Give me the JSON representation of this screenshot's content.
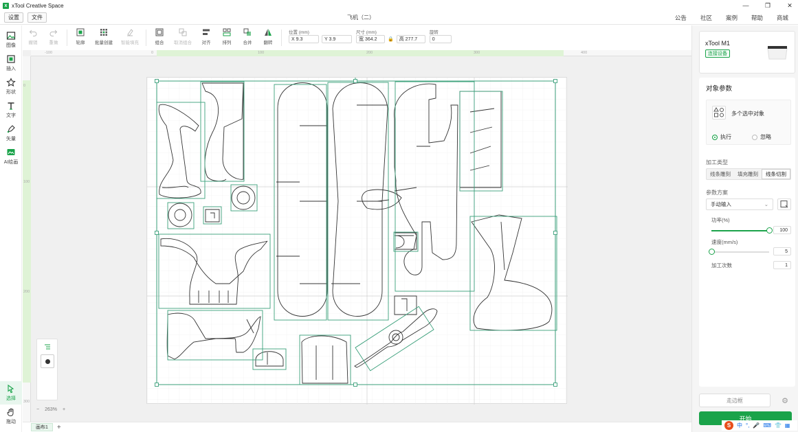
{
  "app": {
    "title": "xTool Creative Space",
    "logo_letter": "x"
  },
  "window": {
    "minimize": "—",
    "maximize": "❐",
    "close": "✕"
  },
  "menu": {
    "settings": "设置",
    "file": "文件",
    "doc_title": "飞机（二）"
  },
  "topnav": [
    "公告",
    "社区",
    "案例",
    "帮助",
    "商城"
  ],
  "leftbar": [
    {
      "label": "图像",
      "icon": "image-icon"
    },
    {
      "label": "插入",
      "icon": "insert-icon"
    },
    {
      "label": "形状",
      "icon": "star-icon"
    },
    {
      "label": "文字",
      "icon": "text-icon"
    },
    {
      "label": "矢量",
      "icon": "pen-icon"
    },
    {
      "label": "AI绘画",
      "icon": "ai-paint-icon"
    }
  ],
  "leftbar_bottom": [
    {
      "label": "选择",
      "icon": "pointer-icon"
    },
    {
      "label": "拖动",
      "icon": "hand-icon"
    }
  ],
  "toolbar": {
    "undo": "撤销",
    "redo": "重做",
    "outline": "轮廓",
    "batch": "批量创建",
    "smart_fill": "智能填充",
    "group": "组合",
    "ungroup": "取消组合",
    "align": "对齐",
    "arrange": "排列",
    "combine": "合并",
    "flip": "翻转",
    "position_label": "位置 (mm)",
    "x_value": "X  9.3",
    "y_value": "Y  3.9",
    "size_label": "尺寸 (mm)",
    "w_value": "宽  364.2",
    "h_value": "高  277.7",
    "rotate_label": "旋转",
    "rotate_value": "0"
  },
  "ruler": {
    "top": [
      "-100",
      "0",
      "100",
      "200",
      "300",
      "400"
    ],
    "left": [
      "0",
      "100",
      "200",
      "300"
    ]
  },
  "canvas": {
    "zoom": "263%",
    "zoom_minus": "−",
    "zoom_plus": "+"
  },
  "tabs": {
    "tab1": "画布1",
    "add": "+"
  },
  "device": {
    "name": "xTool M1",
    "connect": "连接设备"
  },
  "params": {
    "title": "对象参数",
    "multi_selected": "多个选中对象",
    "execute": "执行",
    "ignore": "忽略",
    "process_type_label": "加工类型",
    "process_types": [
      "线条雕刻",
      "填充雕刻",
      "线条切割"
    ],
    "active_process": 2,
    "preset_label": "参数方案",
    "preset_value": "手动输入",
    "power_label": "功率(%)",
    "power_value": "100",
    "power": 1.0,
    "speed_label": "速度(mm/s)",
    "speed_value": "5",
    "speed": 0.0,
    "passes_label": "加工次数",
    "passes_value": "1"
  },
  "actions": {
    "frame": "走边框",
    "start": "开始"
  },
  "ime": {
    "logo": "S",
    "lang": "中",
    "items": [
      "°,",
      "🎤",
      "⌨",
      "👕",
      "▦"
    ]
  },
  "colors": {
    "accent": "#1aa34a",
    "cut_line": "#3a9f7a",
    "shape_line": "#333333"
  }
}
